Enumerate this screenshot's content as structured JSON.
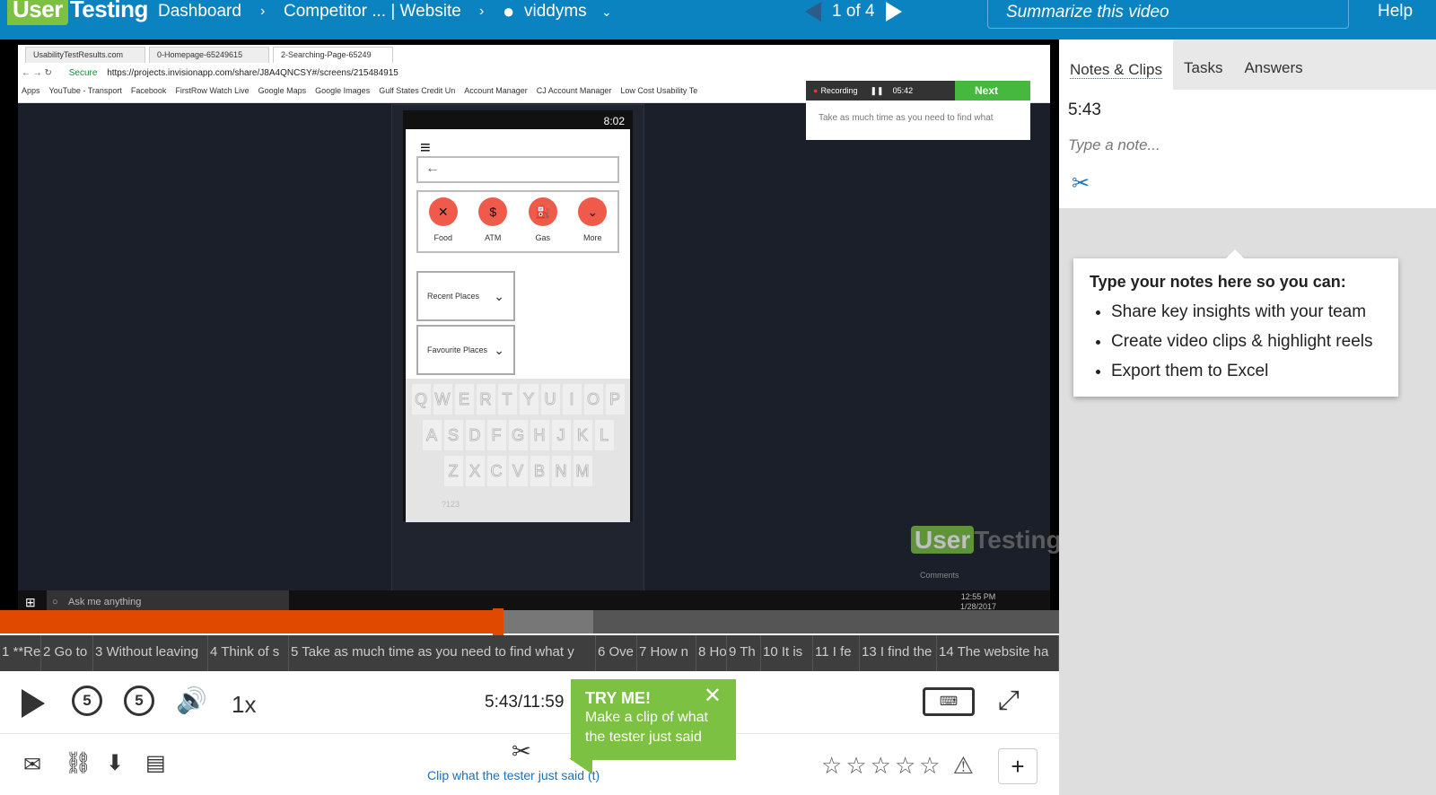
{
  "header": {
    "logo_user": "User",
    "logo_testing": "Testing",
    "breadcrumbs": [
      "Dashboard",
      "Competitor ... | Website",
      "viddyms"
    ],
    "counter": "1 of 4",
    "summarize": "Summarize this video",
    "help": "Help"
  },
  "browser": {
    "tabs": [
      "UsabilityTestResults.com",
      "0-Homepage-65249615",
      "2-Searching-Page-65249"
    ],
    "secure": "Secure",
    "url": "https://projects.invisionapp.com/share/J8A4QNCSY#/screens/215484915",
    "bookmarks": [
      "Apps",
      "YouTube - Transport",
      "Facebook",
      "FirstRow Watch Live",
      "Google Maps",
      "Google Images",
      "Gulf States Credit Un",
      "Account Manager",
      "CJ Account Manager",
      "Low Cost Usability Te"
    ]
  },
  "recorder": {
    "label": "Recording",
    "time": "05:42",
    "next": "Next",
    "tip": "Take as much time as you need to find what"
  },
  "phone": {
    "time": "8:02",
    "categories": [
      "Food",
      "ATM",
      "Gas",
      "More"
    ],
    "dropdown1": "Recent Places",
    "dropdown2": "Favourite Places",
    "row1": [
      "Q",
      "W",
      "E",
      "R",
      "T",
      "Y",
      "U",
      "I",
      "O",
      "P"
    ],
    "row2": [
      "A",
      "S",
      "D",
      "F",
      "G",
      "H",
      "J",
      "K",
      "L"
    ],
    "row3": [
      "Z",
      "X",
      "C",
      "V",
      "B",
      "N",
      "M"
    ],
    "numkey": "?123"
  },
  "watermark": {
    "user": "User",
    "testing": "Testing"
  },
  "taskbar": {
    "search": "Ask me anything",
    "clock": "12:55 PM",
    "date": "1/28/2017",
    "comments": "Comments"
  },
  "playback": {
    "progress_pct": 47,
    "buffered_pct": 56,
    "current": "5:43/11:59",
    "speed": "1x",
    "rewind_seconds": "5",
    "forward_seconds": "5"
  },
  "tasks": [
    "1 **Re",
    "2 Go to",
    "3 Without leaving",
    "4 Think of s",
    "5 Take as much time as you need to find what y",
    "6 Ove",
    "7 How n",
    "8 Ho",
    "9 Th",
    "10 It is",
    "11 I fe",
    "13 I find the",
    "14 The website ha"
  ],
  "try_me": {
    "title": "TRY ME!",
    "body": "Make a clip of what the tester just said"
  },
  "bottom": {
    "clip_link": "Clip what the tester just said (t)",
    "rating": 0,
    "plus": "+"
  },
  "panel": {
    "tabs": [
      "Notes & Clips",
      "Tasks",
      "Answers"
    ],
    "note_time": "5:43",
    "note_placeholder": "Type a note...",
    "tip_title": "Type your notes here so you can:",
    "tip_items": [
      "Share key insights with your team",
      "Create video clips & highlight reels",
      "Export them to Excel"
    ]
  }
}
